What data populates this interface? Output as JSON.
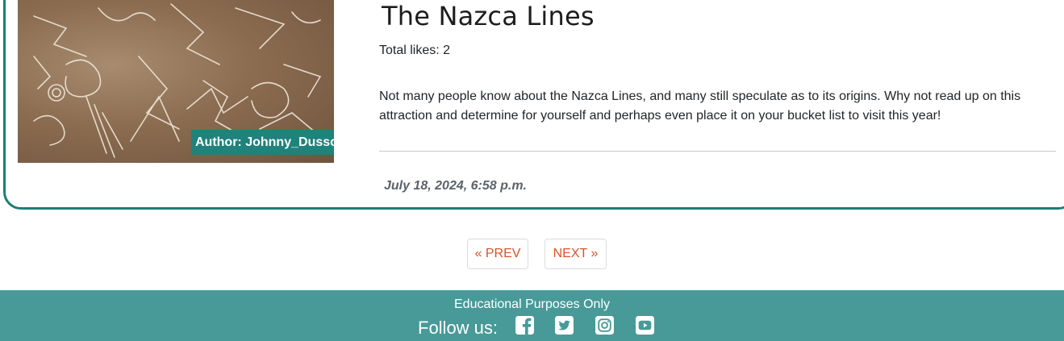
{
  "post": {
    "title": "The Nazca Lines",
    "likes": "Total likes: 2",
    "description": "Not many people know about the Nazca Lines, and many still speculate as to its origins. Why not read up on this attraction and determine for yourself and perhaps even place it on your bucket list to visit this year!",
    "author": "Author: Johnny_Dussot",
    "date": "July 18, 2024, 6:58 p.m."
  },
  "pagination": {
    "prev_label": "« PREV",
    "next_label": "NEXT »"
  },
  "footer": {
    "note": "Educational Purposes Only",
    "follow_label": "Follow us:",
    "social": [
      {
        "icon": "facebook-icon"
      },
      {
        "icon": "twitter-icon"
      },
      {
        "icon": "instagram-icon"
      },
      {
        "icon": "youtube-icon"
      }
    ]
  },
  "colors": {
    "accent": "#1f7c77",
    "footer_bg": "#489a98",
    "pagination_text": "#d9532d"
  }
}
